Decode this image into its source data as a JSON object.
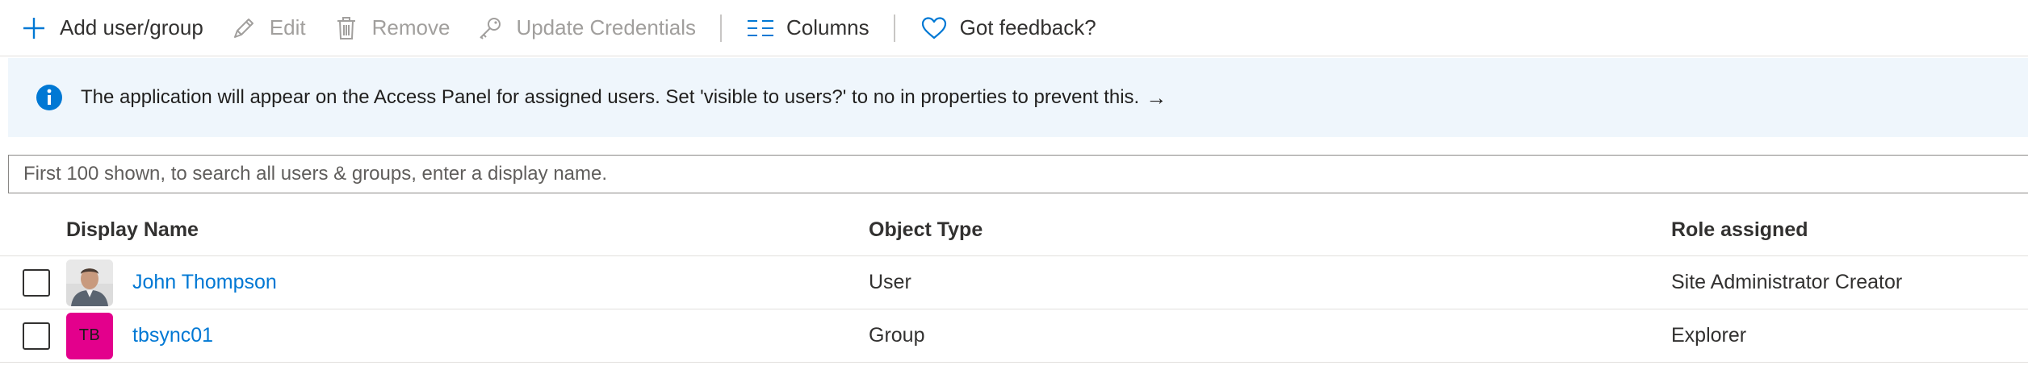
{
  "toolbar": {
    "add_label": "Add user/group",
    "edit_label": "Edit",
    "remove_label": "Remove",
    "update_label": "Update Credentials",
    "columns_label": "Columns",
    "feedback_label": "Got feedback?"
  },
  "icons": {
    "add": "plus-icon",
    "edit": "pencil-icon",
    "remove": "trash-icon",
    "update": "key-icon",
    "columns": "columns-list-icon",
    "feedback": "heart-icon",
    "info": "info-icon",
    "arrow": "arrow-right-icon"
  },
  "banner": {
    "text": "The application will appear on the Access Panel for assigned users. Set 'visible to users?' to no in properties to prevent this.",
    "arrow": "→"
  },
  "search": {
    "placeholder": "First 100 shown, to search all users & groups, enter a display name."
  },
  "table": {
    "headers": {
      "name": "Display Name",
      "type": "Object Type",
      "role": "Role assigned"
    },
    "rows": [
      {
        "name": "John Thompson",
        "type": "User",
        "role": "Site Administrator Creator",
        "avatar": "photo"
      },
      {
        "name": "tbsync01",
        "type": "Group",
        "role": "Explorer",
        "avatar_initials": "TB"
      }
    ]
  },
  "colors": {
    "accent": "#0078d4",
    "banner_bg": "#eff6fc",
    "group_avatar": "#e3008c",
    "disabled": "#a19f9d"
  }
}
